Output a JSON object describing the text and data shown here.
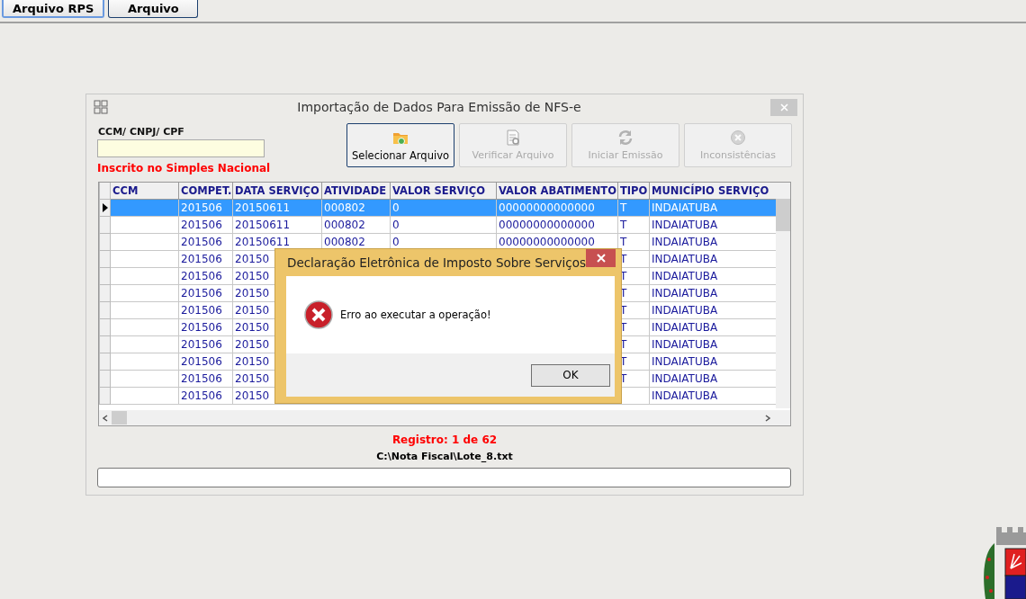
{
  "menu": [
    {
      "label": "Arquivo RPS",
      "selected": true
    },
    {
      "label": "Arquivo",
      "selected": false
    }
  ],
  "window": {
    "title": "Importação de Dados Para Emissão de NFS-e",
    "id_label": "CCM/ CNPJ/ CPF",
    "tax_status": "Inscrito no Simples Nacional",
    "toolbar": [
      {
        "kind": "folder",
        "label": "Selecionar Arquivo",
        "disabled": false
      },
      {
        "kind": "verify",
        "label": "Verificar Arquivo",
        "disabled": true
      },
      {
        "kind": "refresh",
        "label": "Iniciar Emissão",
        "disabled": true
      },
      {
        "kind": "error",
        "label": "Inconsistências",
        "disabled": true
      }
    ],
    "table": {
      "columns": [
        "CCM",
        "COMPET.",
        "DATA SERVIÇO",
        "ATIVIDADE",
        "VALOR SERVIÇO",
        "VALOR ABATIMENTO",
        "TIPO",
        "MUNICÍPIO SERVIÇO"
      ],
      "rows": [
        {
          "selected": true,
          "cells": [
            null,
            "201506",
            "20150611",
            "000802",
            "0",
            "00000000000000",
            "T",
            "INDAIATUBA"
          ]
        },
        {
          "selected": false,
          "cells": [
            null,
            "201506",
            "20150611",
            "000802",
            "0",
            "00000000000000",
            "T",
            "INDAIATUBA"
          ]
        },
        {
          "selected": false,
          "cells": [
            null,
            "201506",
            "20150611",
            "000802",
            "0",
            "00000000000000",
            "T",
            "INDAIATUBA"
          ]
        },
        {
          "selected": false,
          "cells": [
            null,
            "201506",
            "20150",
            null,
            null,
            null,
            "T",
            "INDAIATUBA"
          ]
        },
        {
          "selected": false,
          "cells": [
            null,
            "201506",
            "20150",
            null,
            null,
            null,
            "T",
            "INDAIATUBA"
          ]
        },
        {
          "selected": false,
          "cells": [
            null,
            "201506",
            "20150",
            null,
            null,
            null,
            "T",
            "INDAIATUBA"
          ]
        },
        {
          "selected": false,
          "cells": [
            null,
            "201506",
            "20150",
            null,
            null,
            null,
            "T",
            "INDAIATUBA"
          ]
        },
        {
          "selected": false,
          "cells": [
            null,
            "201506",
            "20150",
            null,
            null,
            null,
            "T",
            "INDAIATUBA"
          ]
        },
        {
          "selected": false,
          "cells": [
            null,
            "201506",
            "20150",
            null,
            null,
            null,
            "T",
            "INDAIATUBA"
          ]
        },
        {
          "selected": false,
          "cells": [
            null,
            "201506",
            "20150",
            null,
            null,
            null,
            "T",
            "INDAIATUBA"
          ]
        },
        {
          "selected": false,
          "cells": [
            null,
            "201506",
            "20150",
            null,
            null,
            null,
            "T",
            "INDAIATUBA"
          ]
        },
        {
          "selected": false,
          "cells": [
            null,
            "201506",
            "20150",
            null,
            null,
            null,
            null,
            "INDAIATUBA"
          ]
        }
      ]
    },
    "record": "Registro: 1 de 62",
    "file_path": "C:\\Nota Fiscal\\Lote_8.txt",
    "progress": {
      "level": 0
    }
  },
  "dialog": {
    "title": "Declaração Eletrônica de Imposto Sobre Serviços",
    "message": "Erro ao executar a operação!",
    "button": "OK"
  }
}
